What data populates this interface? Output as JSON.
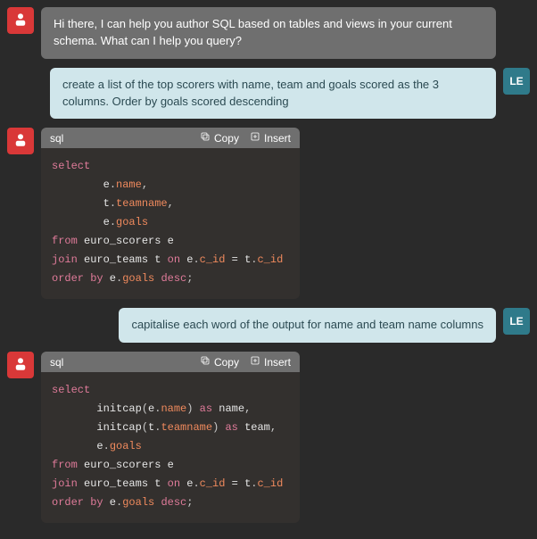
{
  "avatars": {
    "user_initials": "LE"
  },
  "messages": {
    "bot_intro": "Hi there, I can help you author SQL based on tables and views in your current schema. What can I help you query?",
    "user_1": "create a list of the top scorers with name, team and goals scored as the 3 columns. Order by goals scored descending",
    "user_2": "capitalise each word of the output for name and team name columns"
  },
  "code_ui": {
    "lang_label": "sql",
    "copy_label": "Copy",
    "insert_label": "Insert"
  },
  "chart_data": [
    {
      "type": "table",
      "title": "SQL response 1",
      "language": "sql",
      "tokens": [
        [
          "kw",
          "select"
        ],
        [
          "nl",
          ""
        ],
        [
          "ind",
          "        "
        ],
        [
          "id",
          "e"
        ],
        [
          "pale",
          "."
        ],
        [
          "col",
          "name"
        ],
        [
          "pale",
          ","
        ],
        [
          "nl",
          ""
        ],
        [
          "ind",
          "        "
        ],
        [
          "id",
          "t"
        ],
        [
          "pale",
          "."
        ],
        [
          "col",
          "teamname"
        ],
        [
          "pale",
          ","
        ],
        [
          "nl",
          ""
        ],
        [
          "ind",
          "        "
        ],
        [
          "id",
          "e"
        ],
        [
          "pale",
          "."
        ],
        [
          "col",
          "goals"
        ],
        [
          "nl",
          ""
        ],
        [
          "kw",
          "from"
        ],
        [
          "id",
          " euro_scorers e"
        ],
        [
          "nl",
          ""
        ],
        [
          "kw",
          "join"
        ],
        [
          "id",
          " euro_teams t "
        ],
        [
          "kw",
          "on"
        ],
        [
          "id",
          " e"
        ],
        [
          "pale",
          "."
        ],
        [
          "col",
          "c_id"
        ],
        [
          "id",
          " = t"
        ],
        [
          "pale",
          "."
        ],
        [
          "col",
          "c_id"
        ],
        [
          "nl",
          ""
        ],
        [
          "kw",
          "order by"
        ],
        [
          "id",
          " e"
        ],
        [
          "pale",
          "."
        ],
        [
          "col",
          "goals"
        ],
        [
          "id",
          " "
        ],
        [
          "kw",
          "desc"
        ],
        [
          "pale",
          ";"
        ]
      ]
    },
    {
      "type": "table",
      "title": "SQL response 2",
      "language": "sql",
      "tokens": [
        [
          "kw",
          "select"
        ],
        [
          "nl",
          ""
        ],
        [
          "ind",
          "       "
        ],
        [
          "fn",
          "initcap"
        ],
        [
          "pale",
          "("
        ],
        [
          "id",
          "e"
        ],
        [
          "pale",
          "."
        ],
        [
          "col",
          "name"
        ],
        [
          "pale",
          ") "
        ],
        [
          "kw",
          "as"
        ],
        [
          "id",
          " name"
        ],
        [
          "pale",
          ","
        ],
        [
          "nl",
          ""
        ],
        [
          "ind",
          "       "
        ],
        [
          "fn",
          "initcap"
        ],
        [
          "pale",
          "("
        ],
        [
          "id",
          "t"
        ],
        [
          "pale",
          "."
        ],
        [
          "col",
          "teamname"
        ],
        [
          "pale",
          ") "
        ],
        [
          "kw",
          "as"
        ],
        [
          "id",
          " team"
        ],
        [
          "pale",
          ","
        ],
        [
          "nl",
          ""
        ],
        [
          "ind",
          "       "
        ],
        [
          "id",
          "e"
        ],
        [
          "pale",
          "."
        ],
        [
          "col",
          "goals"
        ],
        [
          "nl",
          ""
        ],
        [
          "kw",
          "from"
        ],
        [
          "id",
          " euro_scorers e"
        ],
        [
          "nl",
          ""
        ],
        [
          "kw",
          "join"
        ],
        [
          "id",
          " euro_teams t "
        ],
        [
          "kw",
          "on"
        ],
        [
          "id",
          " e"
        ],
        [
          "pale",
          "."
        ],
        [
          "col",
          "c_id"
        ],
        [
          "id",
          " = t"
        ],
        [
          "pale",
          "."
        ],
        [
          "col",
          "c_id"
        ],
        [
          "nl",
          ""
        ],
        [
          "kw",
          "order by"
        ],
        [
          "id",
          " e"
        ],
        [
          "pale",
          "."
        ],
        [
          "col",
          "goals"
        ],
        [
          "id",
          " "
        ],
        [
          "kw",
          "desc"
        ],
        [
          "pale",
          ";"
        ]
      ]
    }
  ]
}
